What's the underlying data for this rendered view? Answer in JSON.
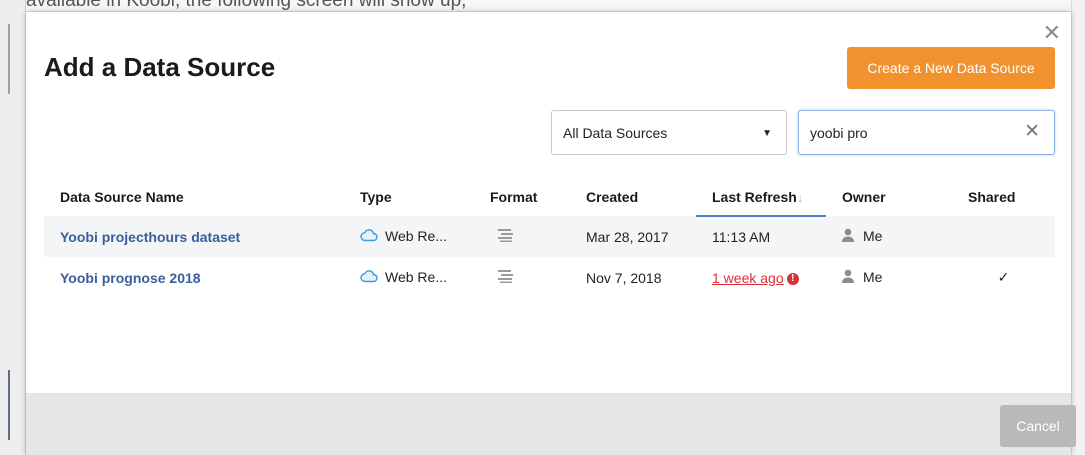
{
  "background": {
    "top_text": "available in Koobi, the following screen will show up,"
  },
  "modal": {
    "title": "Add a Data Source",
    "create_button_label": "Create a New Data Source",
    "close_icon": "close-icon",
    "filter": {
      "selected": "All Data Sources",
      "caret": "▼"
    },
    "search": {
      "value": "yoobi pro",
      "clear_icon": "close-icon"
    },
    "table": {
      "headers": [
        "Data Source Name",
        "Type",
        "Format",
        "Created",
        "Last Refresh",
        "Owner",
        "Shared"
      ],
      "sort_icon": "↓",
      "rows": [
        {
          "name": "Yoobi projecthours dataset",
          "type": "Web Re...",
          "type_icon": "cloud-icon",
          "format_icon": "text-lines-icon",
          "created": "Mar 28, 2017",
          "last_refresh": "11:13 AM",
          "refresh_warning": false,
          "owner": "Me",
          "owner_icon": "person-icon",
          "shared": ""
        },
        {
          "name": "Yoobi prognose 2018",
          "type": "Web Re...",
          "type_icon": "cloud-icon",
          "format_icon": "text-lines-icon",
          "created": "Nov 7, 2018",
          "last_refresh": "1 week ago",
          "refresh_warning": true,
          "warning_symbol": "!",
          "owner": "Me",
          "owner_icon": "person-icon",
          "shared": "✓"
        }
      ]
    },
    "cancel_button_label": "Cancel"
  },
  "colors": {
    "accent_orange": "#f2922e",
    "link_blue": "#3b5f9b",
    "warning_red": "#d9303a",
    "active_underline": "#4f7ec7",
    "footer_bg": "#e5e6e8"
  }
}
